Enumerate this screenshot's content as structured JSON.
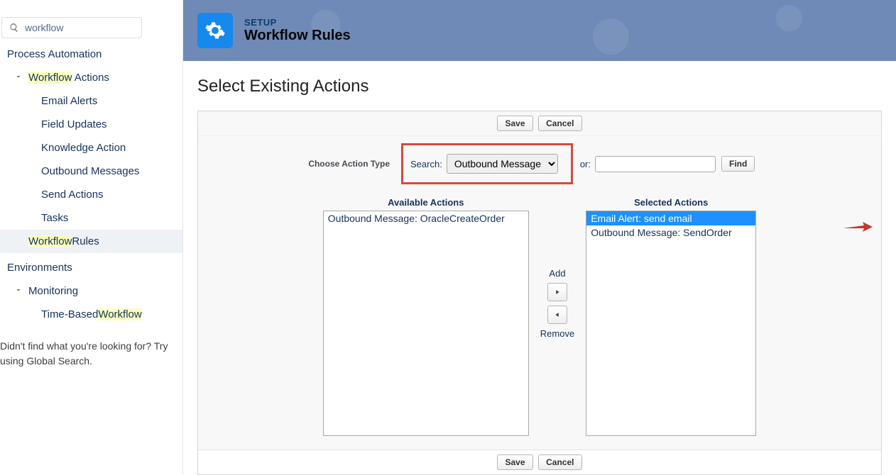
{
  "sidebar": {
    "search_value": "workflow",
    "section": "Process Automation",
    "group1": {
      "label_hl": "Workflow",
      "label_rest": " Actions"
    },
    "children1": [
      "Email Alerts",
      "Field Updates",
      "Knowledge Action",
      "Outbound Messages",
      "Send Actions",
      "Tasks"
    ],
    "rules": {
      "label_hl": "Workflow",
      "label_rest": " Rules"
    },
    "section2": "Environments",
    "group2": "Monitoring",
    "child2": {
      "label_pre": "Time-Based ",
      "label_hl": "Workflow"
    },
    "not_found": "Didn't find what you're looking for? Try using Global Search."
  },
  "header": {
    "setup": "SETUP",
    "title": "Workflow Rules"
  },
  "content": {
    "heading": "Select Existing Actions",
    "save": "Save",
    "cancel": "Cancel",
    "choose_label": "Choose Action Type",
    "search_label": "Search:",
    "action_type_value": "Outbound Message",
    "for_label": "or:",
    "for_value": "",
    "find": "Find",
    "available_title": "Available Actions",
    "selected_title": "Selected Actions",
    "available_items": [
      "Outbound Message: OracleCreateOrder"
    ],
    "selected_items": [
      "Email Alert: send email",
      "Outbound Message: SendOrder"
    ],
    "add": "Add",
    "remove": "Remove"
  }
}
